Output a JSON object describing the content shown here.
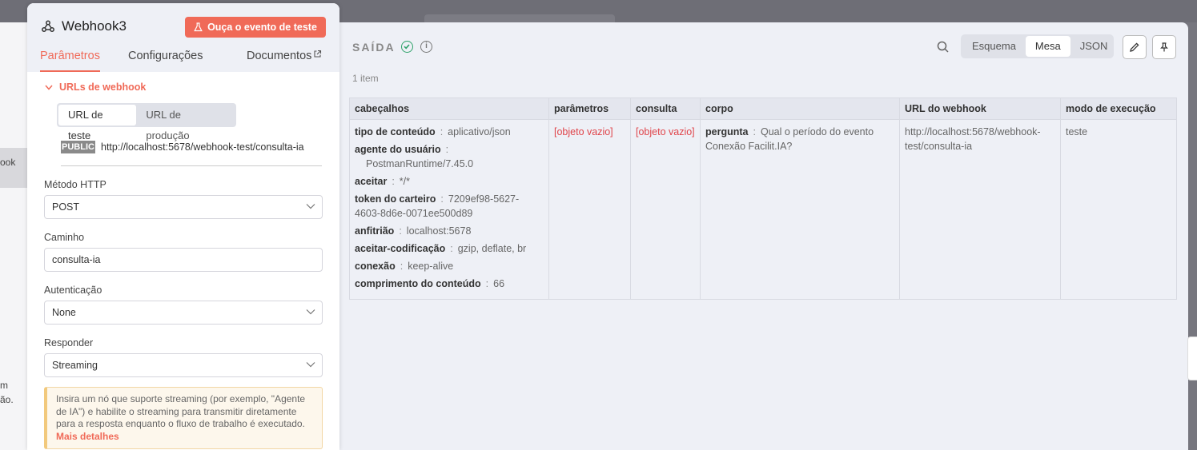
{
  "background": {
    "node_label": "ook",
    "stray_text_1": "m",
    "stray_text_2": "ão."
  },
  "node": {
    "title": "Webhook3",
    "listen_button": "Ouça o evento de teste",
    "tabs": [
      "Parâmetros",
      "Configurações",
      "Documentos"
    ]
  },
  "params": {
    "section_title": "URLs de webhook",
    "url_toggle": {
      "options": [
        "URL de teste",
        "URL de produção"
      ],
      "selected": "URL de teste"
    },
    "public_badge": "PUBLIC",
    "url": "http://localhost:5678/webhook-test/consulta-ia",
    "http_method": {
      "label": "Método HTTP",
      "value": "POST"
    },
    "path": {
      "label": "Caminho",
      "value": "consulta-ia"
    },
    "auth": {
      "label": "Autenticação",
      "value": "None"
    },
    "respond": {
      "label": "Responder",
      "value": "Streaming"
    },
    "notice": {
      "text": "Insira um nó que suporte streaming (por exemplo, \"Agente de IA\") e habilite o streaming para transmitir diretamente para a resposta enquanto o fluxo de trabalho é executado.",
      "link": "Mais detalhes"
    }
  },
  "output": {
    "title": "SAÍDA",
    "modes": [
      "Esquema",
      "Mesa",
      "JSON"
    ],
    "active_mode": "Mesa",
    "item_count": "1 item",
    "columns": [
      "cabeçalhos",
      "parâmetros",
      "consulta",
      "corpo",
      "URL do webhook",
      "modo de execução"
    ],
    "headers": [
      {
        "key": "tipo de conteúdo",
        "value": "aplicativo/json"
      },
      {
        "key": "agente do usuário",
        "value": "PostmanRuntime/7.45.0"
      },
      {
        "key": "aceitar",
        "value": "*/*"
      },
      {
        "key": "token do carteiro",
        "value": "7209ef98-5627-4603-8d6e-0071ee500d89"
      },
      {
        "key": "anfitrião",
        "value": "localhost:5678"
      },
      {
        "key": "aceitar-codificação",
        "value": "gzip, deflate, br"
      },
      {
        "key": "conexão",
        "value": "keep-alive"
      },
      {
        "key": "comprimento do conteúdo",
        "value": "66"
      }
    ],
    "parametros": "[objeto vazio]",
    "consulta": "[objeto vazio]",
    "corpo": {
      "key": "pergunta",
      "value": "Qual o período do evento Conexão Facilit.IA?"
    },
    "webhook_url": "http://localhost:5678/webhook-test/consulta-ia",
    "execution_mode": "teste"
  },
  "colors": {
    "accent": "#f06a58",
    "success": "#2fa26a",
    "empty_value": "#e0454b"
  }
}
